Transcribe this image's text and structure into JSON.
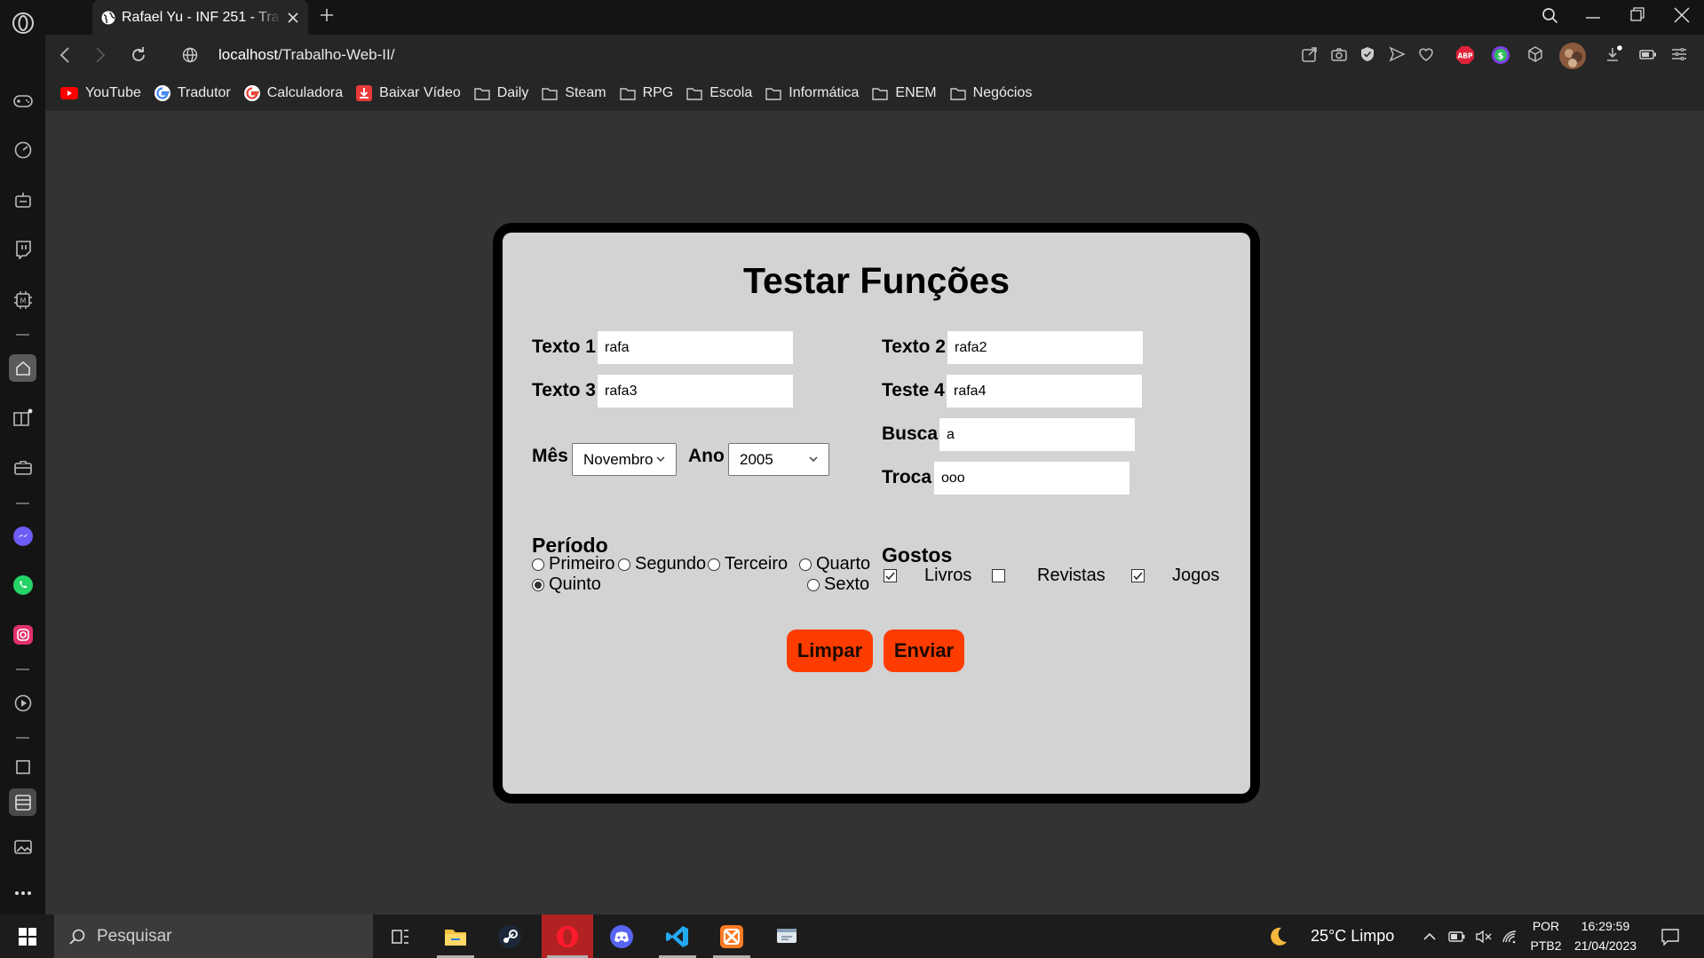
{
  "browser": {
    "tab_title": "Rafael Yu - INF 251 - Trabalho Web II",
    "url_host": "localhost",
    "url_path": "/Trabalho-Web-II/"
  },
  "bookmarks": [
    {
      "label": "YouTube",
      "icon": "youtube-icon"
    },
    {
      "label": "Tradutor",
      "icon": "google-icon"
    },
    {
      "label": "Calculadora",
      "icon": "google-icon"
    },
    {
      "label": "Baixar Vídeo",
      "icon": "download-icon"
    },
    {
      "label": "Daily",
      "icon": "folder-icon"
    },
    {
      "label": "Steam",
      "icon": "folder-icon"
    },
    {
      "label": "RPG",
      "icon": "folder-icon"
    },
    {
      "label": "Escola",
      "icon": "folder-icon"
    },
    {
      "label": "Informática",
      "icon": "folder-icon"
    },
    {
      "label": "ENEM",
      "icon": "folder-icon"
    },
    {
      "label": "Negócios",
      "icon": "folder-icon"
    }
  ],
  "form": {
    "title": "Testar Funções",
    "texto1": {
      "label": "Texto 1",
      "value": "rafa"
    },
    "texto2": {
      "label": "Texto 2",
      "value": "rafa2"
    },
    "texto3": {
      "label": "Texto 3",
      "value": "rafa3"
    },
    "teste4": {
      "label": "Teste 4",
      "value": "rafa4"
    },
    "busca": {
      "label": "Busca",
      "value": "a"
    },
    "troca": {
      "label": "Troca",
      "value": "ooo"
    },
    "mes": {
      "label": "Mês",
      "value": "Novembro"
    },
    "ano": {
      "label": "Ano",
      "value": "2005"
    },
    "periodo": {
      "label": "Período",
      "options": [
        "Primeiro",
        "Segundo",
        "Terceiro",
        "Quarto",
        "Quinto",
        "Sexto"
      ],
      "selected": "Quinto"
    },
    "gostos": {
      "label": "Gostos",
      "options": [
        {
          "label": "Livros",
          "checked": true
        },
        {
          "label": "Revistas",
          "checked": false
        },
        {
          "label": "Jogos",
          "checked": true
        }
      ]
    },
    "buttons": {
      "clear": "Limpar",
      "submit": "Enviar"
    }
  },
  "taskbar": {
    "search_placeholder": "Pesquisar",
    "weather": "25°C  Limpo",
    "lang_top": "POR",
    "lang_bottom": "PTB2",
    "time": "16:29:59",
    "date": "21/04/2023"
  },
  "colors": {
    "accent_button": "#ff3c00",
    "card_bg": "#d3d3d3",
    "page_bg": "#333333"
  }
}
